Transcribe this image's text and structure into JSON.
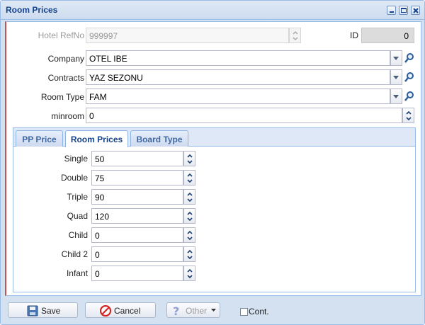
{
  "window": {
    "title": "Room Prices"
  },
  "form": {
    "hotel_refno": {
      "label": "Hotel RefNo",
      "value": "999997"
    },
    "id": {
      "label": "ID",
      "value": "0"
    },
    "company": {
      "label": "Company",
      "value": "OTEL IBE"
    },
    "contracts": {
      "label": "Contracts",
      "value": "YAZ SEZONU"
    },
    "room_type": {
      "label": "Room Type",
      "value": "FAM"
    },
    "minroom": {
      "label": "minroom",
      "value": "0"
    }
  },
  "tabs": [
    {
      "label": "PP Price",
      "active": false
    },
    {
      "label": "Room Prices",
      "active": true
    },
    {
      "label": "Board Type",
      "active": false
    }
  ],
  "prices": [
    {
      "label": "Single",
      "value": "50"
    },
    {
      "label": "Double",
      "value": "75"
    },
    {
      "label": "Triple",
      "value": "90"
    },
    {
      "label": "Quad",
      "value": "120"
    },
    {
      "label": "Child",
      "value": "0"
    },
    {
      "label": "Child 2",
      "value": "0"
    },
    {
      "label": "Infant",
      "value": "0"
    }
  ],
  "footer": {
    "save_label": "Save",
    "cancel_label": "Cancel",
    "other_label": "Other",
    "cont_label": "Cont."
  },
  "icons": {
    "save": "floppy-icon",
    "cancel": "no-entry-icon",
    "other": "question-icon",
    "lookup": "magnifier-icon"
  },
  "colors": {
    "header_text": "#15428b",
    "panel_bg": "#d3e1f1",
    "border": "#99bbe8",
    "accent_red": "#c9514a"
  }
}
